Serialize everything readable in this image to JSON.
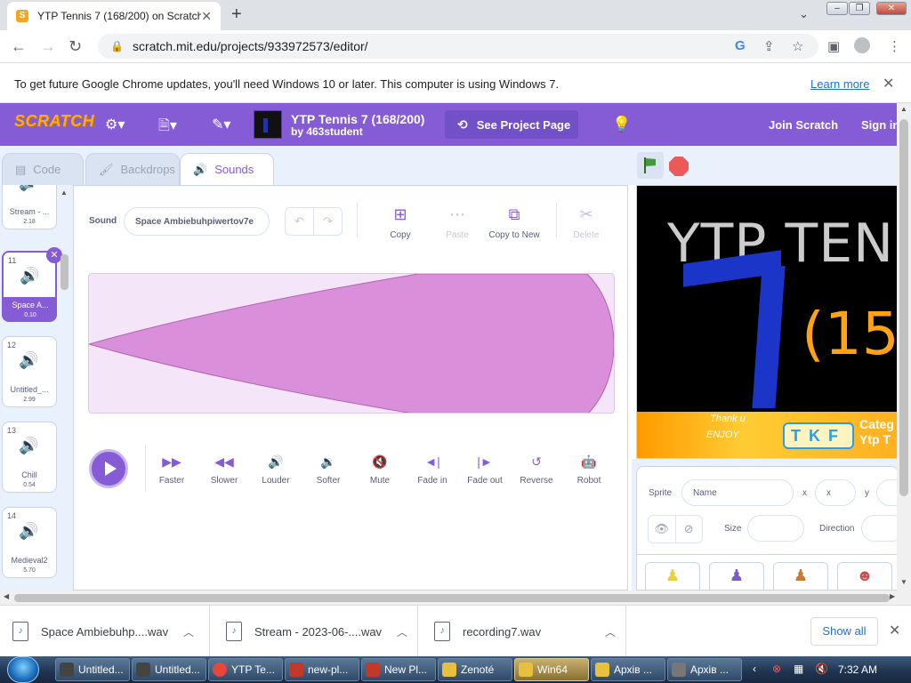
{
  "browser": {
    "tab_title": "YTP Tennis 7 (168/200) on Scratch",
    "tab_close": "✕",
    "new_tab": "+",
    "url": "scratch.mit.edu/projects/933972573/editor/",
    "infobar": {
      "message": "To get future Google Chrome updates, you'll need Windows 10 or later. This computer is using Windows 7.",
      "link": "Learn more"
    }
  },
  "scratch": {
    "logo": "SCRATCH",
    "project_title": "YTP Tennis 7 (168/200)",
    "project_by": "by 463student",
    "see_project_page": "See Project Page",
    "join": "Join Scratch",
    "signin": "Sign in",
    "tabs": [
      {
        "label": "Code",
        "icon": "code-icon"
      },
      {
        "label": "Backdrops",
        "icon": "brush-icon"
      },
      {
        "label": "Sounds",
        "icon": "speaker-icon",
        "active": true
      }
    ],
    "sound_list": [
      {
        "num": "",
        "name": "Stream - ...",
        "duration": "2.18"
      },
      {
        "num": "11",
        "name": "Space A...",
        "duration": "0.10",
        "selected": true
      },
      {
        "num": "12",
        "name": "Untitled_...",
        "duration": "2.99"
      },
      {
        "num": "13",
        "name": "Chill",
        "duration": "0.54"
      },
      {
        "num": "14",
        "name": "Medieval2",
        "duration": "5.70"
      }
    ],
    "editor": {
      "sound_label": "Sound",
      "sound_name": "Space Ambiebuhpiwertov7e",
      "copy": "Copy",
      "paste": "Paste",
      "copy_to_new": "Copy to New",
      "delete": "Delete",
      "effects": [
        "Faster",
        "Slower",
        "Louder",
        "Softer",
        "Mute",
        "Fade in",
        "Fade out",
        "Reverse",
        "Robot"
      ]
    },
    "stage": {
      "title_text": "YTP TENN",
      "paren_text": "(15",
      "tkf": "TKF",
      "banner_text1": "Thank u",
      "banner_text2": "ENJOY",
      "cat_line1": "Categ",
      "cat_line2": "Ytp T"
    },
    "sprite_info": {
      "sprite_label": "Sprite",
      "name_placeholder": "Name",
      "x_label": "x",
      "x_placeholder": "x",
      "y_label": "y",
      "size_label": "Size",
      "direction_label": "Direction"
    }
  },
  "downloads": [
    {
      "name": "Space Ambiebuhp....wav"
    },
    {
      "name": "Stream - 2023-06-....wav"
    },
    {
      "name": "recording7.wav"
    }
  ],
  "show_all": "Show all",
  "taskbar": {
    "items": [
      {
        "label": "Untitled...",
        "color": "#444"
      },
      {
        "label": "Untitled...",
        "color": "#444"
      },
      {
        "label": "YTP Te...",
        "color": "#e8453c"
      },
      {
        "label": "new-pl...",
        "color": "#c0392b"
      },
      {
        "label": "New Pl...",
        "color": "#c0392b"
      },
      {
        "label": "Zenoté",
        "color": "#e8c040"
      },
      {
        "label": "Win64",
        "color": "#e8c040",
        "active": true
      },
      {
        "label": "Архів ...",
        "color": "#e8c040"
      },
      {
        "label": "Архів ...",
        "color": "#777"
      }
    ],
    "time": "7:32 AM"
  }
}
